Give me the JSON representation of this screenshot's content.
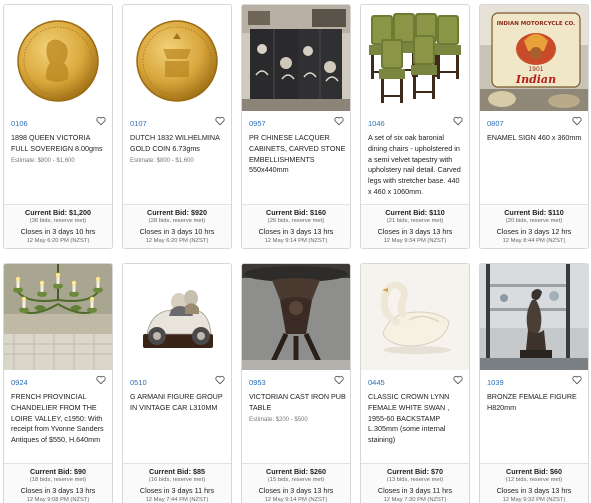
{
  "lots": [
    {
      "lot_number": "0106",
      "title": "1898 QUEEN VICTORIA FULL SOVEREIGN 8.00gms",
      "estimate": "Estimate: $800 - $1,600",
      "current_bid": "Current Bid: $1,200",
      "bids_info": "(36 bids, reserve met)",
      "closes": "Closes in 3 days 10 hrs",
      "close_date": "12 May 6:20 PM (NZST)",
      "image": "gold-coin-victoria"
    },
    {
      "lot_number": "0107",
      "title": "DUTCH 1832 WILHELMINA GOLD COIN 6.73gms",
      "estimate": "Estimate: $800 - $1,600",
      "current_bid": "Current Bid: $920",
      "bids_info": "(28 bids, reserve met)",
      "closes": "Closes in 3 days 10 hrs",
      "close_date": "12 May 6:20 PM (NZST)",
      "image": "gold-coin-dutch"
    },
    {
      "lot_number": "0957",
      "title": "PR CHINESE LACQUER CABINETS, CARVED STONE EMBELLISHMENTS 550x440mm",
      "estimate": "",
      "current_bid": "Current Bid: $160",
      "bids_info": "(26 bids, reserve met)",
      "closes": "Closes in 3 days 13 hrs",
      "close_date": "12 May 9:14 PM (NZST)",
      "image": "lacquer-cabinets"
    },
    {
      "lot_number": "1046",
      "title": "A set of six oak baronial dining chairs - upholstered in a semi velvet tapestry with upholstery nail detail. Carved legs with stretcher base. 440 x 460 x 1060mm.",
      "estimate": "",
      "current_bid": "Current Bid: $110",
      "bids_info": "(21 bids, reserve met)",
      "closes": "Closes in 3 days 13 hrs",
      "close_date": "12 May 9:34 PM (NZST)",
      "image": "dining-chairs"
    },
    {
      "lot_number": "0807",
      "title": "ENAMEL SIGN 460 x 360mm",
      "estimate": "",
      "current_bid": "Current Bid: $110",
      "bids_info": "(20 bids, reserve met)",
      "closes": "Closes in 3 days 12 hrs",
      "close_date": "12 May 8:44 PM (NZST)",
      "image": "enamel-sign",
      "image_text": [
        "INDIAN MOTORCYCLE CO.",
        "1901",
        "Indian"
      ]
    },
    {
      "lot_number": "0924",
      "title": "FRENCH PROVINCIAL CHANDELIER FROM THE LOIRE VALLEY, c1950: With receipt from Yvonne Sanders Antiques of $550, H.640mm",
      "estimate": "",
      "current_bid": "Current Bid: $90",
      "bids_info": "(18 bids, reserve met)",
      "closes": "Closes in 3 days 13 hrs",
      "close_date": "12 May 9:08 PM (NZST)",
      "image": "chandelier"
    },
    {
      "lot_number": "0510",
      "title": "G ARMANI FIGURE GROUP IN VINTAGE CAR L310MM",
      "estimate": "",
      "current_bid": "Current Bid: $85",
      "bids_info": "(16 bids, reserve met)",
      "closes": "Closes in 3 days 11 hrs",
      "close_date": "12 May 7:44 PM (NZST)",
      "image": "vintage-car-figure"
    },
    {
      "lot_number": "0953",
      "title": "VICTORIAN CAST IRON PUB TABLE",
      "estimate": "Estimate: $200 - $500",
      "current_bid": "Current Bid: $260",
      "bids_info": "(15 bids, reserve met)",
      "closes": "Closes in 3 days 13 hrs",
      "close_date": "12 May 9:14 PM (NZST)",
      "image": "cast-iron-table"
    },
    {
      "lot_number": "0445",
      "title": "CLASSIC CROWN LYNN FEMALE WHITE SWAN , 1955-60 BACKSTAMP L.305mm (some internal staining)",
      "estimate": "",
      "current_bid": "Current Bid: $70",
      "bids_info": "(13 bids, reserve met)",
      "closes": "Closes in 3 days 11 hrs",
      "close_date": "12 May 7:30 PM (NZST)",
      "image": "white-swan"
    },
    {
      "lot_number": "1039",
      "title": "BRONZE FEMALE FIGURE H820mm",
      "estimate": "",
      "current_bid": "Current Bid: $60",
      "bids_info": "(12 bids, reserve met)",
      "closes": "Closes in 3 days 13 hrs",
      "close_date": "12 May 9:32 PM (NZST)",
      "image": "bronze-figure"
    }
  ],
  "colors": {
    "lot_number": "#2a6fb7",
    "card_border": "#d7d7d7",
    "gold": "#c99a2e"
  }
}
